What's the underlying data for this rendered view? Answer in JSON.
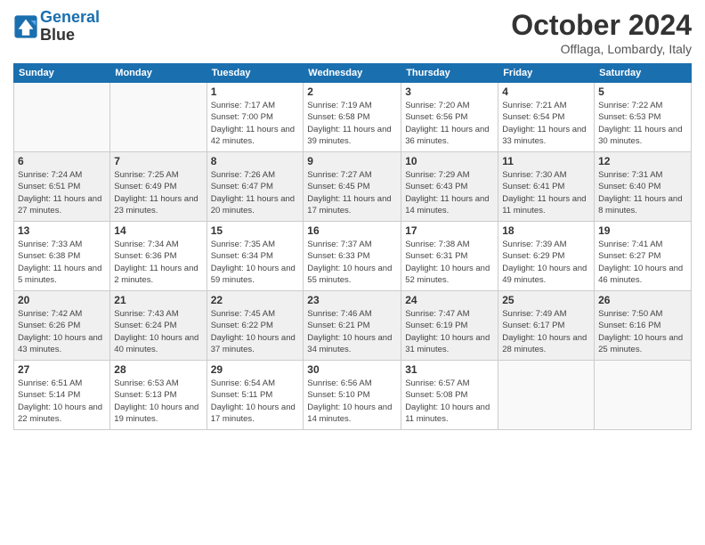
{
  "header": {
    "logo_line1": "General",
    "logo_line2": "Blue",
    "month": "October 2024",
    "location": "Offlaga, Lombardy, Italy"
  },
  "columns": [
    "Sunday",
    "Monday",
    "Tuesday",
    "Wednesday",
    "Thursday",
    "Friday",
    "Saturday"
  ],
  "weeks": [
    [
      {
        "day": "",
        "info": ""
      },
      {
        "day": "",
        "info": ""
      },
      {
        "day": "1",
        "info": "Sunrise: 7:17 AM\nSunset: 7:00 PM\nDaylight: 11 hours and 42 minutes."
      },
      {
        "day": "2",
        "info": "Sunrise: 7:19 AM\nSunset: 6:58 PM\nDaylight: 11 hours and 39 minutes."
      },
      {
        "day": "3",
        "info": "Sunrise: 7:20 AM\nSunset: 6:56 PM\nDaylight: 11 hours and 36 minutes."
      },
      {
        "day": "4",
        "info": "Sunrise: 7:21 AM\nSunset: 6:54 PM\nDaylight: 11 hours and 33 minutes."
      },
      {
        "day": "5",
        "info": "Sunrise: 7:22 AM\nSunset: 6:53 PM\nDaylight: 11 hours and 30 minutes."
      }
    ],
    [
      {
        "day": "6",
        "info": "Sunrise: 7:24 AM\nSunset: 6:51 PM\nDaylight: 11 hours and 27 minutes."
      },
      {
        "day": "7",
        "info": "Sunrise: 7:25 AM\nSunset: 6:49 PM\nDaylight: 11 hours and 23 minutes."
      },
      {
        "day": "8",
        "info": "Sunrise: 7:26 AM\nSunset: 6:47 PM\nDaylight: 11 hours and 20 minutes."
      },
      {
        "day": "9",
        "info": "Sunrise: 7:27 AM\nSunset: 6:45 PM\nDaylight: 11 hours and 17 minutes."
      },
      {
        "day": "10",
        "info": "Sunrise: 7:29 AM\nSunset: 6:43 PM\nDaylight: 11 hours and 14 minutes."
      },
      {
        "day": "11",
        "info": "Sunrise: 7:30 AM\nSunset: 6:41 PM\nDaylight: 11 hours and 11 minutes."
      },
      {
        "day": "12",
        "info": "Sunrise: 7:31 AM\nSunset: 6:40 PM\nDaylight: 11 hours and 8 minutes."
      }
    ],
    [
      {
        "day": "13",
        "info": "Sunrise: 7:33 AM\nSunset: 6:38 PM\nDaylight: 11 hours and 5 minutes."
      },
      {
        "day": "14",
        "info": "Sunrise: 7:34 AM\nSunset: 6:36 PM\nDaylight: 11 hours and 2 minutes."
      },
      {
        "day": "15",
        "info": "Sunrise: 7:35 AM\nSunset: 6:34 PM\nDaylight: 10 hours and 59 minutes."
      },
      {
        "day": "16",
        "info": "Sunrise: 7:37 AM\nSunset: 6:33 PM\nDaylight: 10 hours and 55 minutes."
      },
      {
        "day": "17",
        "info": "Sunrise: 7:38 AM\nSunset: 6:31 PM\nDaylight: 10 hours and 52 minutes."
      },
      {
        "day": "18",
        "info": "Sunrise: 7:39 AM\nSunset: 6:29 PM\nDaylight: 10 hours and 49 minutes."
      },
      {
        "day": "19",
        "info": "Sunrise: 7:41 AM\nSunset: 6:27 PM\nDaylight: 10 hours and 46 minutes."
      }
    ],
    [
      {
        "day": "20",
        "info": "Sunrise: 7:42 AM\nSunset: 6:26 PM\nDaylight: 10 hours and 43 minutes."
      },
      {
        "day": "21",
        "info": "Sunrise: 7:43 AM\nSunset: 6:24 PM\nDaylight: 10 hours and 40 minutes."
      },
      {
        "day": "22",
        "info": "Sunrise: 7:45 AM\nSunset: 6:22 PM\nDaylight: 10 hours and 37 minutes."
      },
      {
        "day": "23",
        "info": "Sunrise: 7:46 AM\nSunset: 6:21 PM\nDaylight: 10 hours and 34 minutes."
      },
      {
        "day": "24",
        "info": "Sunrise: 7:47 AM\nSunset: 6:19 PM\nDaylight: 10 hours and 31 minutes."
      },
      {
        "day": "25",
        "info": "Sunrise: 7:49 AM\nSunset: 6:17 PM\nDaylight: 10 hours and 28 minutes."
      },
      {
        "day": "26",
        "info": "Sunrise: 7:50 AM\nSunset: 6:16 PM\nDaylight: 10 hours and 25 minutes."
      }
    ],
    [
      {
        "day": "27",
        "info": "Sunrise: 6:51 AM\nSunset: 5:14 PM\nDaylight: 10 hours and 22 minutes."
      },
      {
        "day": "28",
        "info": "Sunrise: 6:53 AM\nSunset: 5:13 PM\nDaylight: 10 hours and 19 minutes."
      },
      {
        "day": "29",
        "info": "Sunrise: 6:54 AM\nSunset: 5:11 PM\nDaylight: 10 hours and 17 minutes."
      },
      {
        "day": "30",
        "info": "Sunrise: 6:56 AM\nSunset: 5:10 PM\nDaylight: 10 hours and 14 minutes."
      },
      {
        "day": "31",
        "info": "Sunrise: 6:57 AM\nSunset: 5:08 PM\nDaylight: 10 hours and 11 minutes."
      },
      {
        "day": "",
        "info": ""
      },
      {
        "day": "",
        "info": ""
      }
    ]
  ]
}
